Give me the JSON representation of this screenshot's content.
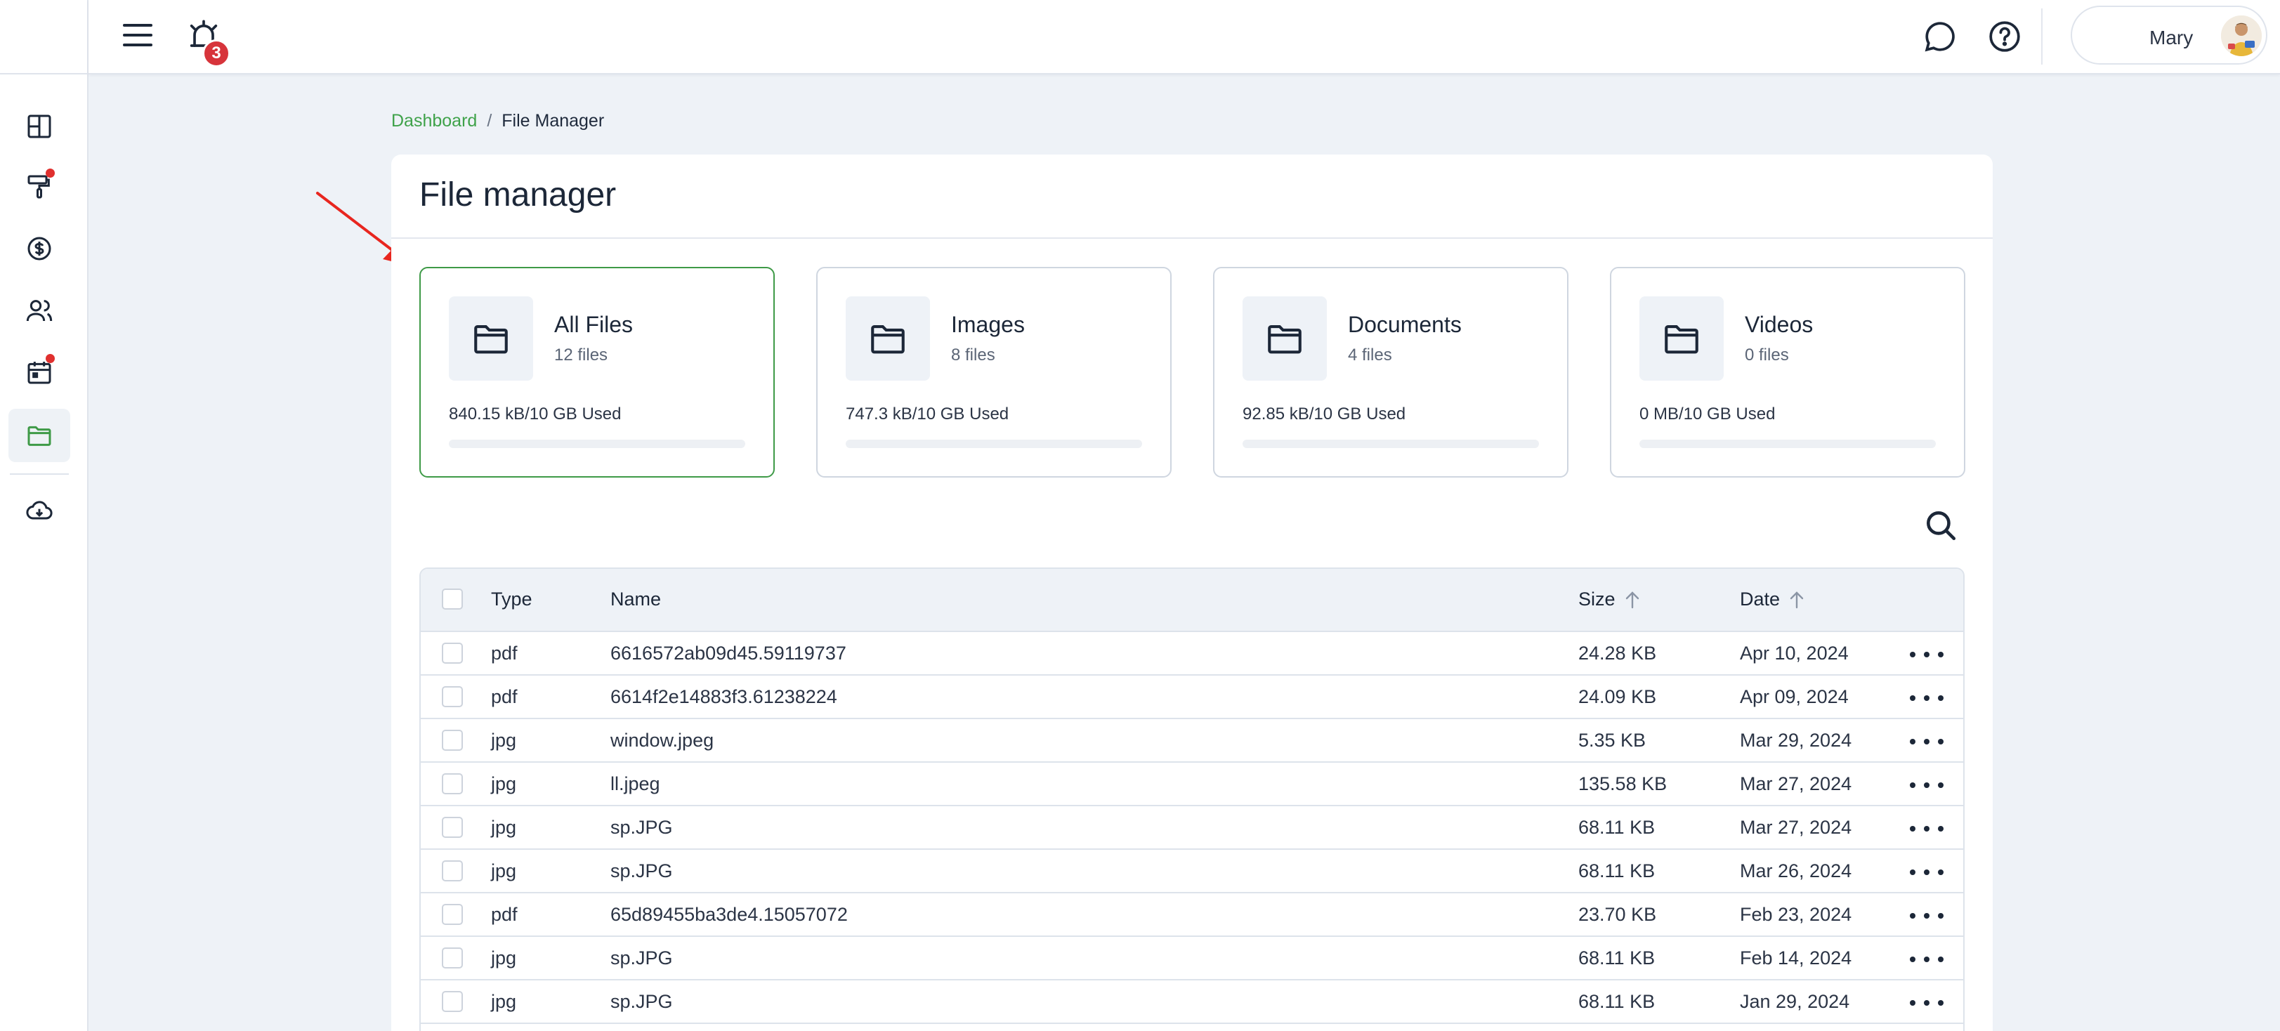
{
  "topbar": {
    "notification_count": "3",
    "user_name": "Mary"
  },
  "breadcrumb": {
    "home": "Dashboard",
    "separator": "/",
    "current": "File Manager"
  },
  "page": {
    "title": "File manager"
  },
  "categories": [
    {
      "name": "All Files",
      "count": "12 files",
      "used": "840.15 kB/10 GB Used",
      "fraction": 0.0001
    },
    {
      "name": "Images",
      "count": "8 files",
      "used": "747.3 kB/10 GB Used",
      "fraction": 0.0001
    },
    {
      "name": "Documents",
      "count": "4 files",
      "used": "92.85 kB/10 GB Used",
      "fraction": 0.0
    },
    {
      "name": "Videos",
      "count": "0 files",
      "used": "0 MB/10 GB Used",
      "fraction": 0.0
    }
  ],
  "table": {
    "headers": {
      "type": "Type",
      "name": "Name",
      "size": "Size",
      "date": "Date"
    },
    "rows": [
      {
        "type": "pdf",
        "name": "6616572ab09d45.59119737",
        "size": "24.28 KB",
        "date": "Apr 10, 2024"
      },
      {
        "type": "pdf",
        "name": "6614f2e14883f3.61238224",
        "size": "24.09 KB",
        "date": "Apr 09, 2024"
      },
      {
        "type": "jpg",
        "name": "window.jpeg",
        "size": "5.35 KB",
        "date": "Mar 29, 2024"
      },
      {
        "type": "jpg",
        "name": "ll.jpeg",
        "size": "135.58 KB",
        "date": "Mar 27, 2024"
      },
      {
        "type": "jpg",
        "name": "sp.JPG",
        "size": "68.11 KB",
        "date": "Mar 27, 2024"
      },
      {
        "type": "jpg",
        "name": "sp.JPG",
        "size": "68.11 KB",
        "date": "Mar 26, 2024"
      },
      {
        "type": "pdf",
        "name": "65d89455ba3de4.15057072",
        "size": "23.70 KB",
        "date": "Feb 23, 2024"
      },
      {
        "type": "jpg",
        "name": "sp.JPG",
        "size": "68.11 KB",
        "date": "Feb 14, 2024"
      },
      {
        "type": "jpg",
        "name": "sp.JPG",
        "size": "68.11 KB",
        "date": "Jan 29, 2024"
      },
      {
        "type": "",
        "name": "",
        "size": "",
        "date": ""
      }
    ]
  },
  "colors": {
    "accent": "#3e9a47",
    "badge": "#d7343b",
    "background": "#eef2f7"
  }
}
